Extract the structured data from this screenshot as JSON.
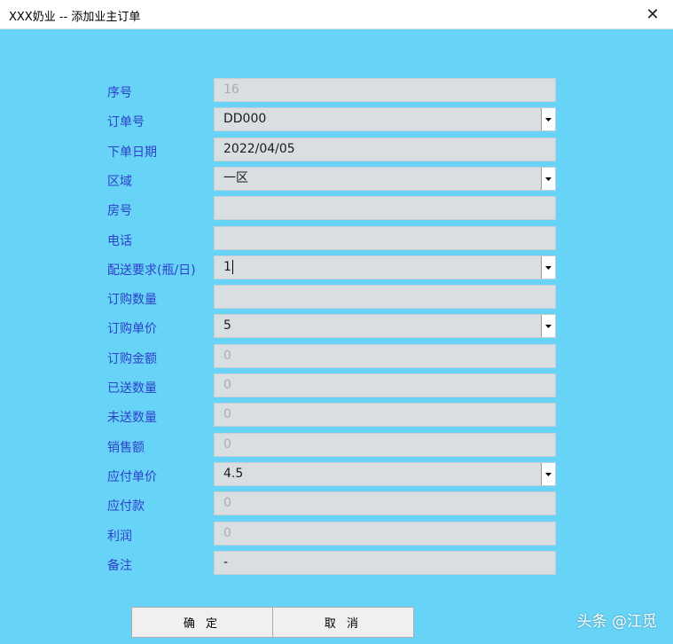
{
  "window": {
    "title": "XXX奶业 -- 添加业主订单",
    "close_symbol": "✕"
  },
  "form": {
    "fields": [
      {
        "label": "序号",
        "value": "16",
        "type": "text",
        "disabled": true
      },
      {
        "label": "订单号",
        "value": "DD000",
        "type": "select",
        "disabled": false
      },
      {
        "label": "下单日期",
        "value": "2022/04/05",
        "type": "text",
        "disabled": false
      },
      {
        "label": "区域",
        "value": "一区",
        "type": "select",
        "disabled": false
      },
      {
        "label": "房号",
        "value": "",
        "type": "text",
        "disabled": false
      },
      {
        "label": "电话",
        "value": "",
        "type": "text",
        "disabled": false
      },
      {
        "label": "配送要求(瓶/日)",
        "value": "1",
        "type": "select",
        "disabled": false
      },
      {
        "label": "订购数量",
        "value": "",
        "type": "text",
        "disabled": false
      },
      {
        "label": "订购单价",
        "value": "5",
        "type": "select",
        "disabled": false
      },
      {
        "label": "订购金额",
        "value": "0",
        "type": "text",
        "disabled": true
      },
      {
        "label": "已送数量",
        "value": "0",
        "type": "text",
        "disabled": true
      },
      {
        "label": "未送数量",
        "value": "0",
        "type": "text",
        "disabled": true
      },
      {
        "label": "销售额",
        "value": "0",
        "type": "text",
        "disabled": true
      },
      {
        "label": "应付单价",
        "value": "4.5",
        "type": "select",
        "disabled": false
      },
      {
        "label": "应付款",
        "value": "0",
        "type": "text",
        "disabled": true
      },
      {
        "label": "利润",
        "value": "0",
        "type": "text",
        "disabled": true
      },
      {
        "label": "备注",
        "value": "-",
        "type": "text",
        "disabled": false
      }
    ]
  },
  "buttons": {
    "confirm_label": "确 定",
    "cancel_label": "取 消"
  },
  "watermark": "头条 @江觅",
  "colors": {
    "background": "#66d3f7",
    "label": "#2f3fc9",
    "field": "#d9dfe1"
  }
}
